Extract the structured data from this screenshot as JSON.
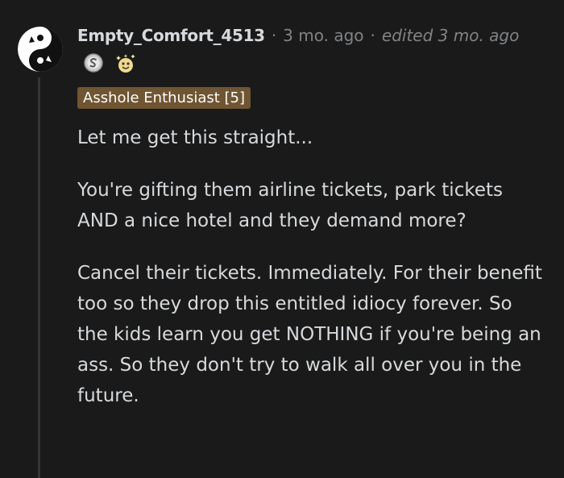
{
  "comment": {
    "username": "Empty_Comfort_4513",
    "separator": "·",
    "age": "3 mo. ago",
    "edited": "edited 3 mo. ago",
    "awards": [
      "silver-award-icon",
      "wholesome-award-icon"
    ],
    "flair": "Asshole Enthusiast [5]",
    "paragraphs": [
      "Let me get this straight...",
      "You're gifting them airline tickets, park tickets AND a nice hotel and they demand more?",
      "Cancel their tickets. Immediately. For their benefit too so they drop this entitled idiocy forever. So the kids learn you get NOTHING if you're being an ass. So they don't try to walk all over you in the future."
    ]
  },
  "colors": {
    "background": "#1a1a1b",
    "text": "#d7dadc",
    "meta": "#818384",
    "flair_bg": "#6f5532",
    "thread_line": "#343536"
  }
}
